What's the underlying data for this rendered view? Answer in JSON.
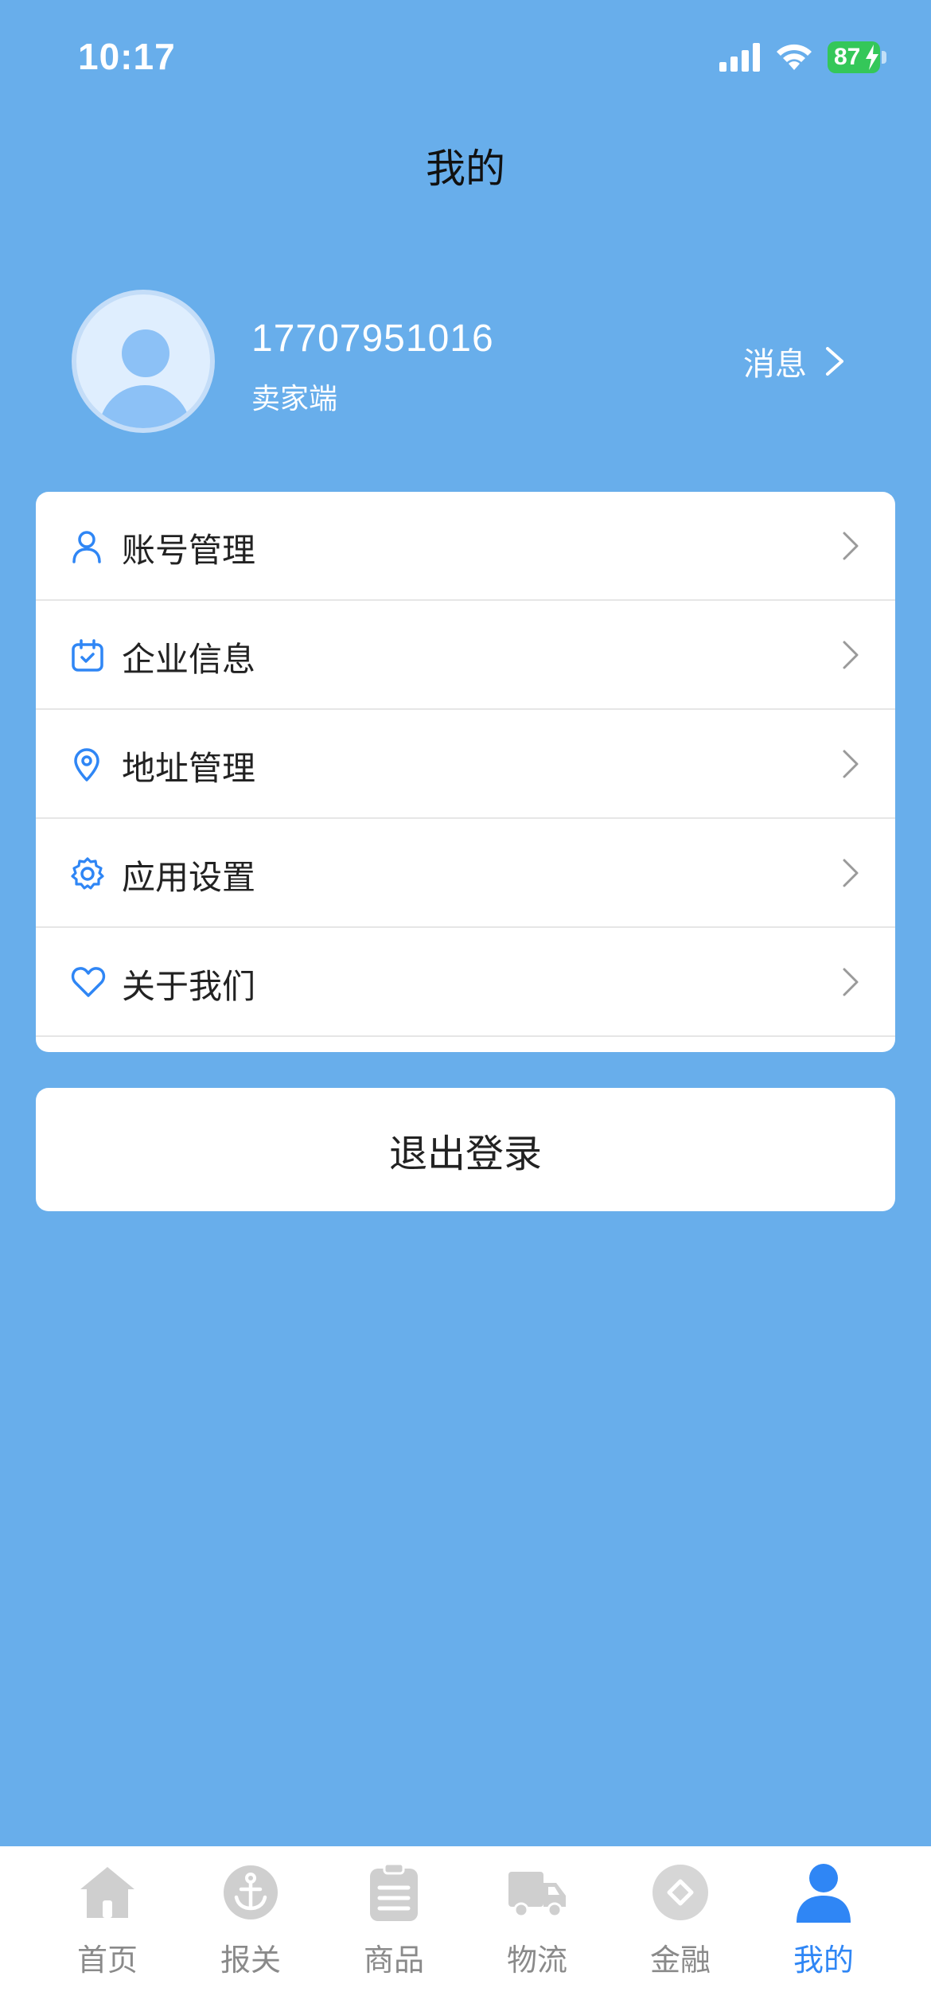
{
  "status_bar": {
    "time": "10:17",
    "battery": "87"
  },
  "header": {
    "title": "我的"
  },
  "profile": {
    "phone": "17707951016",
    "role": "卖家端",
    "message_label": "消息"
  },
  "menu": {
    "items": [
      {
        "label": "账号管理",
        "icon": "user-icon"
      },
      {
        "label": "企业信息",
        "icon": "calendar-check-icon"
      },
      {
        "label": "地址管理",
        "icon": "location-pin-icon"
      },
      {
        "label": "应用设置",
        "icon": "gear-icon"
      },
      {
        "label": "关于我们",
        "icon": "heart-icon"
      }
    ]
  },
  "logout": {
    "label": "退出登录"
  },
  "tab_bar": {
    "tabs": [
      {
        "label": "首页",
        "icon": "home-icon",
        "active": false
      },
      {
        "label": "报关",
        "icon": "anchor-icon",
        "active": false
      },
      {
        "label": "商品",
        "icon": "clipboard-icon",
        "active": false
      },
      {
        "label": "物流",
        "icon": "truck-icon",
        "active": false
      },
      {
        "label": "金融",
        "icon": "finance-diamond-icon",
        "active": false
      },
      {
        "label": "我的",
        "icon": "person-icon",
        "active": true
      }
    ]
  },
  "colors": {
    "background": "#68aeeb",
    "accent": "#2f86f5",
    "tab_inactive": "#8a8a8a",
    "tab_icon_inactive": "#cfcfcf",
    "battery": "#34c759"
  }
}
